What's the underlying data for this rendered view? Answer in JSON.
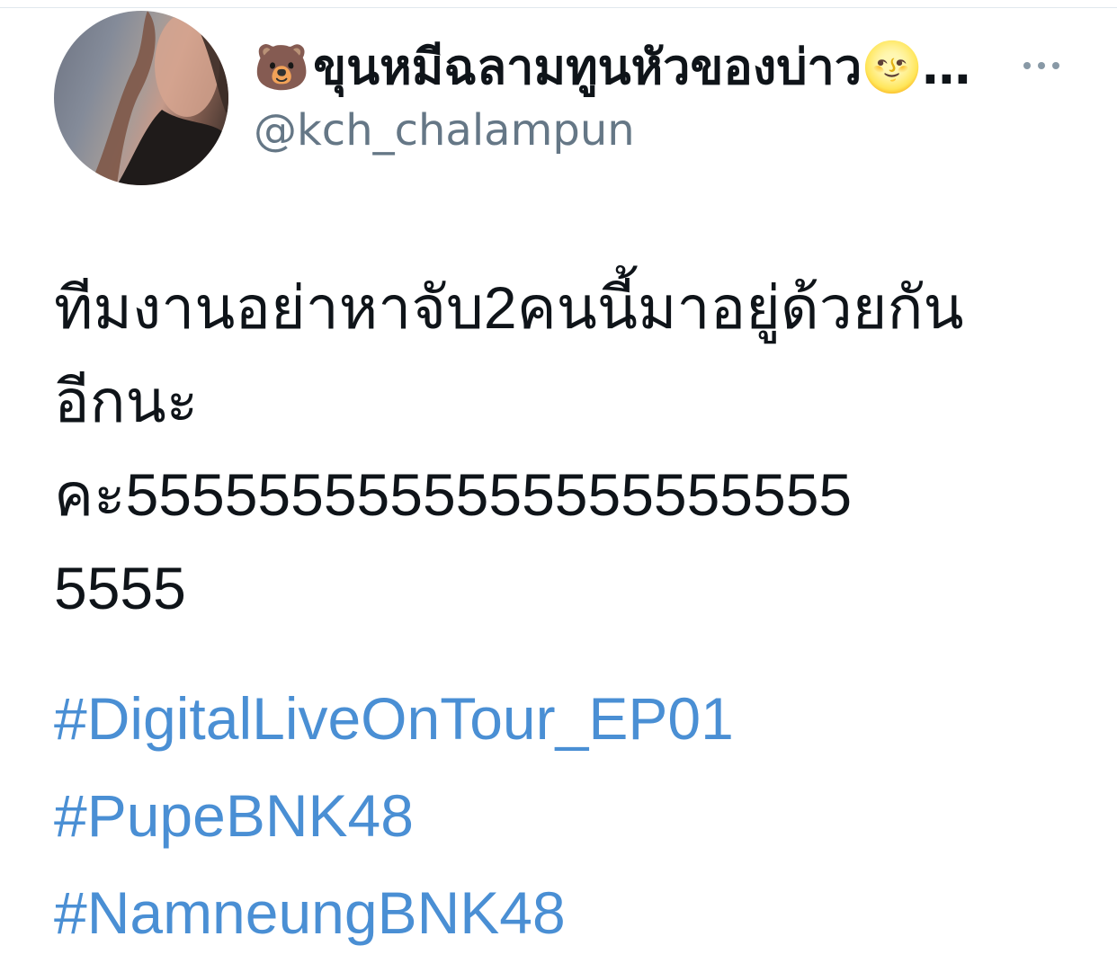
{
  "user": {
    "display_name_prefix_emoji": "🐻",
    "display_name": "ขุนหมีฉลามทูนหัวของบ่าว🌝…",
    "handle": "@kch_chalampun"
  },
  "tweet": {
    "lines": [
      "ทีมงานอย่าหาจับ2คนนี้มาอยู่ด้วยกัน",
      "อีกนะ",
      "คะ5555555555555555555555",
      "5555"
    ],
    "hashtags": [
      " #DigitalLiveOnTour_EP01",
      "#PupeBNK48",
      "#NamneungBNK48"
    ]
  },
  "icons": {
    "more": "more-horizontal-icon",
    "avatar": "profile-avatar"
  },
  "colors": {
    "text": "#0f1419",
    "secondary": "#657786",
    "link": "#4a8fd4"
  }
}
